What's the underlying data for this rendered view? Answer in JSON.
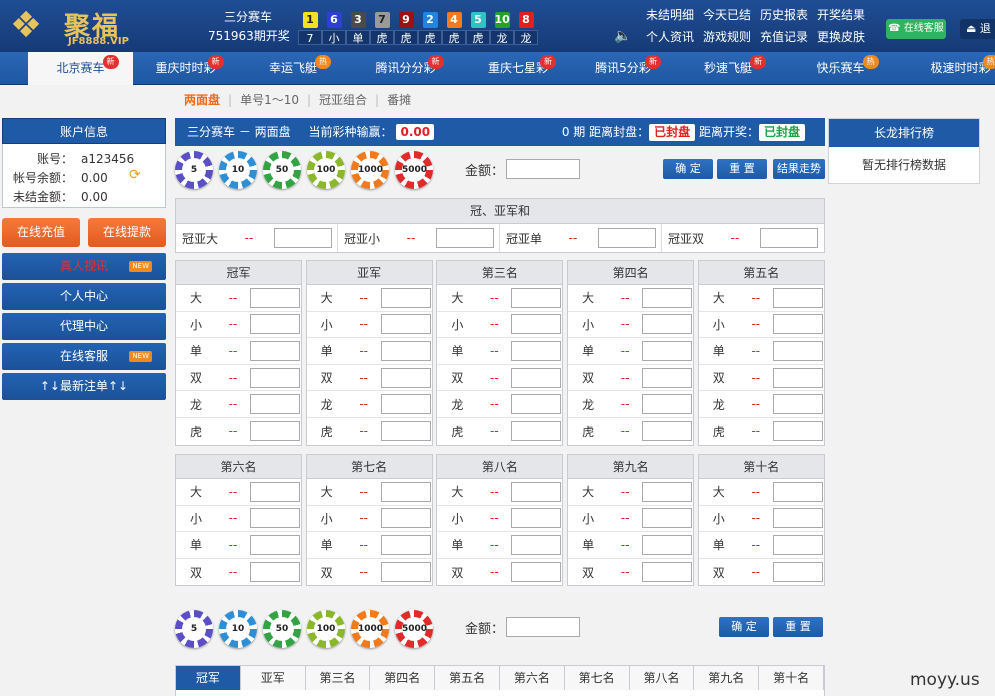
{
  "header": {
    "logo": {
      "name": "聚福",
      "sub": "JF8888.VIP",
      "mark_icon": "lotus-logo-icon"
    },
    "lottery_name": "三分赛车",
    "period": "751963期开奖",
    "balls": [
      {
        "num": "1",
        "color": "#f2e21c",
        "textColor": "#222",
        "result": "7"
      },
      {
        "num": "6",
        "color": "#2d3fd4",
        "textColor": "#fff",
        "result": "小"
      },
      {
        "num": "3",
        "color": "#4a4a4a",
        "textColor": "#fff",
        "result": "单"
      },
      {
        "num": "7",
        "color": "#9a9a9a",
        "textColor": "#222",
        "result": "虎"
      },
      {
        "num": "9",
        "color": "#9b1212",
        "textColor": "#fff",
        "result": "虎"
      },
      {
        "num": "2",
        "color": "#1f86e0",
        "textColor": "#fff",
        "result": "虎"
      },
      {
        "num": "4",
        "color": "#f47a1e",
        "textColor": "#fff",
        "result": "虎"
      },
      {
        "num": "5",
        "color": "#2fc4c4",
        "textColor": "#fff",
        "result": "虎"
      },
      {
        "num": "10",
        "color": "#27a12b",
        "textColor": "#fff",
        "result": "龙"
      },
      {
        "num": "8",
        "color": "#e21e1e",
        "textColor": "#fff",
        "result": "龙"
      }
    ],
    "links": [
      "未结明细",
      "今天已结",
      "历史报表",
      "开奖结果",
      "个人资讯",
      "游戏规则",
      "充值记录",
      "更换皮肤"
    ],
    "cs_button": "在线客服",
    "exit_button": "退"
  },
  "nav": [
    {
      "label": "北京赛车",
      "badge": "新",
      "badgeType": "new",
      "active": true,
      "w": 105
    },
    {
      "label": "重庆时时彩",
      "badge": "新",
      "badgeType": "new",
      "active": false,
      "w": 105
    },
    {
      "label": "幸运飞艇",
      "badge": "热",
      "badgeType": "hot",
      "active": false,
      "w": 110
    },
    {
      "label": "腾讯分分彩",
      "badge": "新",
      "badgeType": "new",
      "active": false,
      "w": 115
    },
    {
      "label": "重庆七星彩",
      "badge": "新",
      "badgeType": "new",
      "active": false,
      "w": 110
    },
    {
      "label": "腾讯5分彩",
      "badge": "新",
      "badgeType": "new",
      "active": false,
      "w": 100
    },
    {
      "label": "秒速飞艇",
      "badge": "新",
      "badgeType": "new",
      "active": false,
      "w": 110
    },
    {
      "label": "快乐赛车",
      "badge": "热",
      "badgeType": "hot",
      "active": false,
      "w": 115
    },
    {
      "label": "极速时时彩",
      "badge": "热",
      "badgeType": "hot",
      "active": false,
      "w": 125
    }
  ],
  "subnav": [
    "两面盘",
    "单号1～10",
    "冠亚组合",
    "番摊"
  ],
  "sidebar": {
    "account_title": "账户信息",
    "rows": [
      {
        "label": "账号：",
        "value": "a123456"
      },
      {
        "label": "帐号余额：",
        "value": "0.00"
      },
      {
        "label": "未结金额：",
        "value": "0.00"
      }
    ],
    "recharge": "在线充值",
    "withdraw": "在线提款",
    "links": [
      {
        "label": "真人视讯",
        "tag": "NEW",
        "red": true
      },
      {
        "label": "个人中心",
        "tag": "",
        "red": false
      },
      {
        "label": "代理中心",
        "tag": "",
        "red": false
      },
      {
        "label": "在线客服",
        "tag": "NEW",
        "red": false
      },
      {
        "label": "↑↓最新注单↑↓",
        "tag": "",
        "red": false
      }
    ]
  },
  "main": {
    "title": "三分赛车 － 两面盘",
    "win_label": "当前彩种输赢：",
    "win_value": "0.00",
    "period_label": "0 期  距离封盘：",
    "close_status": "已封盘",
    "draw_label": "距离开奖：",
    "draw_status": "已封盘",
    "chips": [
      {
        "value": "5",
        "color": "#5a4fc4"
      },
      {
        "value": "10",
        "color": "#2f8fd6"
      },
      {
        "value": "50",
        "color": "#33a344"
      },
      {
        "value": "100",
        "color": "#8ab82a"
      },
      {
        "value": "1000",
        "color": "#f07a1c"
      },
      {
        "value": "5000",
        "color": "#e02b2b"
      }
    ],
    "amount_label": "金额：",
    "confirm": "确 定",
    "reset": "重 置",
    "trend": "结果走势",
    "sum_title": "冠、亚军和",
    "sum_items": [
      {
        "name": "冠亚大",
        "odds": "--"
      },
      {
        "name": "冠亚小",
        "odds": "--"
      },
      {
        "name": "冠亚单",
        "odds": "--"
      },
      {
        "name": "冠亚双",
        "odds": "--"
      }
    ],
    "groups_top": [
      {
        "title": "冠军",
        "rows": [
          "大",
          "小",
          "单",
          "双",
          "龙",
          "虎"
        ]
      },
      {
        "title": "亚军",
        "rows": [
          "大",
          "小",
          "单",
          "双",
          "龙",
          "虎"
        ]
      },
      {
        "title": "第三名",
        "rows": [
          "大",
          "小",
          "单",
          "双",
          "龙",
          "虎"
        ]
      },
      {
        "title": "第四名",
        "rows": [
          "大",
          "小",
          "单",
          "双",
          "龙",
          "虎"
        ]
      },
      {
        "title": "第五名",
        "rows": [
          "大",
          "小",
          "单",
          "双",
          "龙",
          "虎"
        ]
      }
    ],
    "groups_bottom": [
      {
        "title": "第六名",
        "rows": [
          "大",
          "小",
          "单",
          "双"
        ]
      },
      {
        "title": "第七名",
        "rows": [
          "大",
          "小",
          "单",
          "双"
        ]
      },
      {
        "title": "第八名",
        "rows": [
          "大",
          "小",
          "单",
          "双"
        ]
      },
      {
        "title": "第九名",
        "rows": [
          "大",
          "小",
          "单",
          "双"
        ]
      },
      {
        "title": "第十名",
        "rows": [
          "大",
          "小",
          "单",
          "双"
        ]
      }
    ],
    "odds_placeholder": "--",
    "bottom_tabs": [
      "冠军",
      "亚军",
      "第三名",
      "第四名",
      "第五名",
      "第六名",
      "第七名",
      "第八名",
      "第九名",
      "第十名"
    ]
  },
  "rank": {
    "title": "长龙排行榜",
    "empty": "暂无排行榜数据"
  },
  "watermark": "moyy.us"
}
